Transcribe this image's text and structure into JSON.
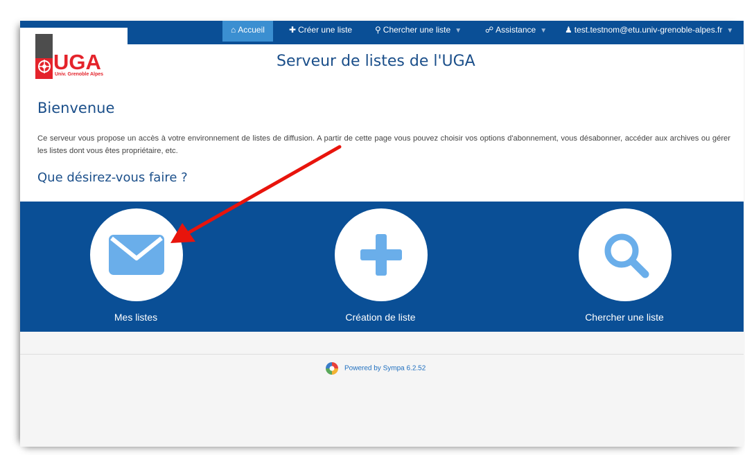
{
  "nav": {
    "items": [
      {
        "icon": "home-icon",
        "label": "Accueil",
        "active": true
      },
      {
        "icon": "plus-icon",
        "label": "Créer une liste",
        "active": false
      },
      {
        "icon": "search-icon",
        "label": "Chercher une liste",
        "active": false,
        "dropdown": true
      },
      {
        "icon": "globe-icon",
        "label": "Assistance",
        "active": false,
        "dropdown": true
      },
      {
        "icon": "user-icon",
        "label": "test.testnom@etu.univ-grenoble-alpes.fr",
        "active": false,
        "dropdown": true
      }
    ]
  },
  "header": {
    "logo_text": "UGA",
    "logo_subtitle": "Univ. Grenoble Alpes",
    "title": "Serveur de listes de l'UGA"
  },
  "main": {
    "welcome_heading": "Bienvenue",
    "intro_text": "Ce serveur vous propose un accès à votre environnement de listes de diffusion. A partir de cette page vous pouvez choisir vos options d'abonnement, vous désabonner, accéder aux archives ou gérer les listes dont vous êtes propriétaire, etc.",
    "question_heading": "Que désirez-vous faire ?"
  },
  "actions": [
    {
      "icon": "envelope-icon",
      "label": "Mes listes"
    },
    {
      "icon": "plus-icon",
      "label": "Création de liste"
    },
    {
      "icon": "search-icon",
      "label": "Chercher une liste"
    }
  ],
  "footer": {
    "powered_by": "Powered by Sympa 6.2.52"
  },
  "colors": {
    "nav_bg": "#0a4f96",
    "nav_active": "#3b8fd1",
    "accent_blue": "#1b4f8a",
    "icon_blue": "#6aaeea",
    "brand_red": "#e4232b",
    "annotation_arrow": "#e8140c"
  }
}
